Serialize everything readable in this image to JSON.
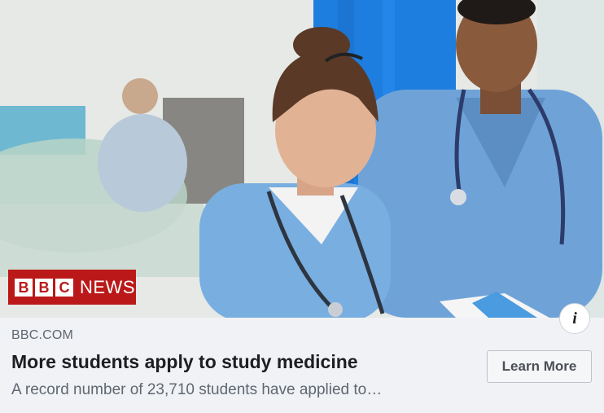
{
  "ad": {
    "image_alt_brand": {
      "bbc_letters": [
        "B",
        "B",
        "C"
      ],
      "news_label": "NEWS"
    },
    "info_glyph": "i",
    "domain": "BBC.COM",
    "headline": "More students apply to study medicine",
    "description": "A record number of 23,710 students have applied to…",
    "cta_label": "Learn More"
  },
  "colors": {
    "bbc_red": "#bb1919",
    "scrub_blue": "#6fa3d8",
    "curtain_blue": "#1e7ee0",
    "text_dark": "#1c1e21",
    "text_muted": "#606770"
  },
  "icons": {
    "info": "info-icon"
  }
}
